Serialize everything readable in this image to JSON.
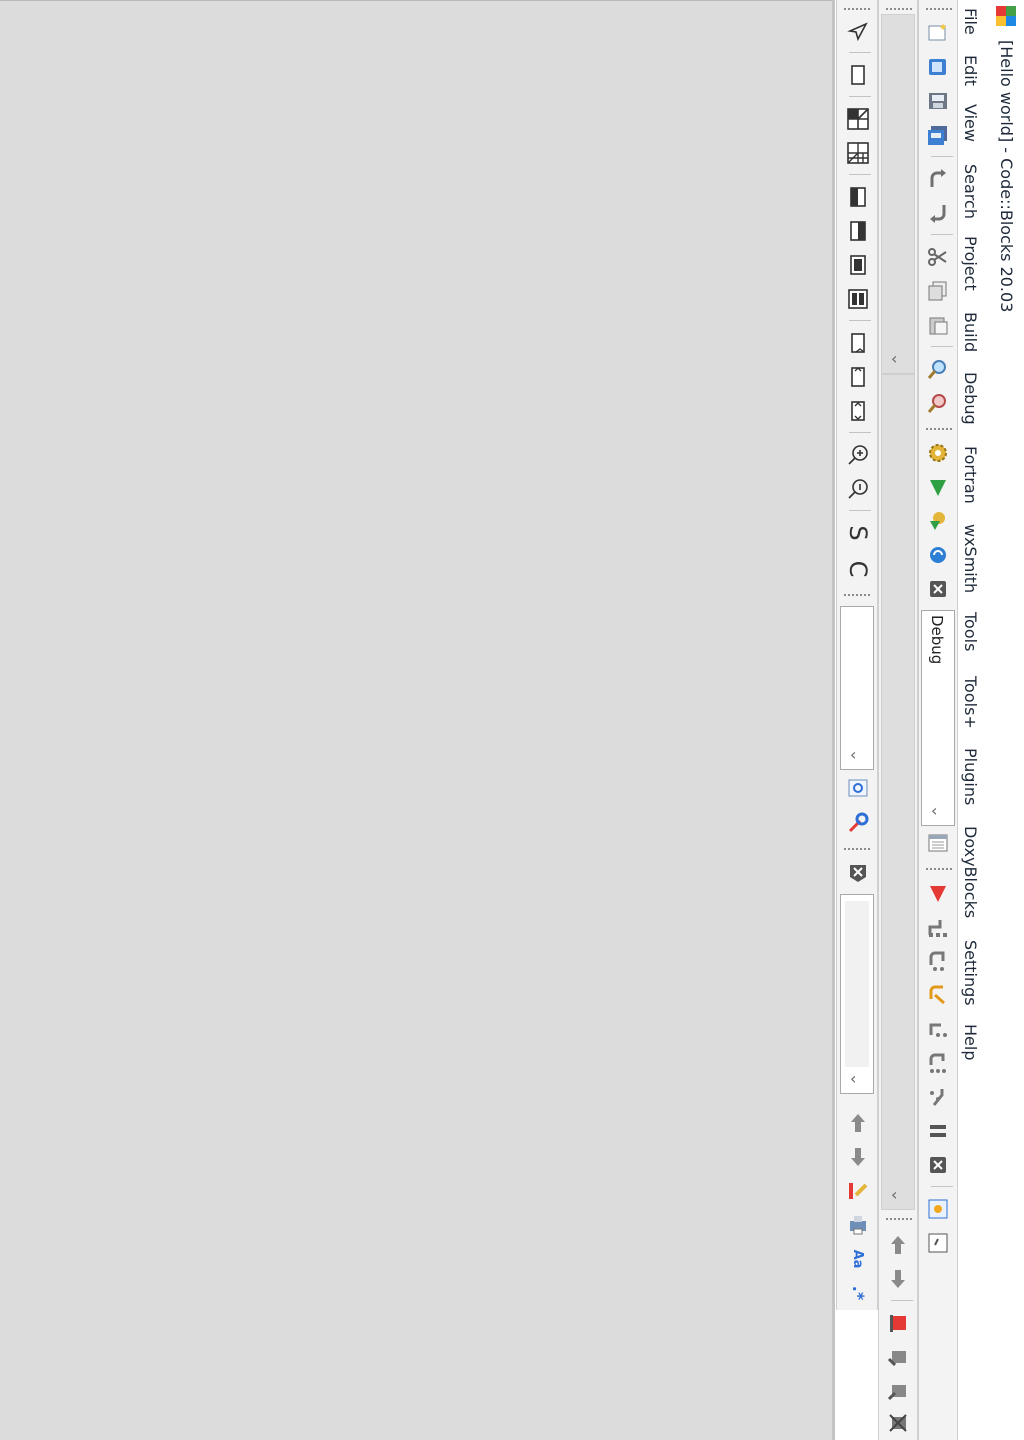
{
  "window": {
    "title": "[Hello world] - Code::Blocks 20.03"
  },
  "menu": {
    "items": [
      "File",
      "Edit",
      "View",
      "Search",
      "Project",
      "Build",
      "Debug",
      "Fortran",
      "wxSmith",
      "Tools",
      "Tools+",
      "Plugins",
      "DoxyBlocks",
      "Settings",
      "Help"
    ]
  },
  "debug_toolbar": {
    "target_label": "Debug"
  },
  "icons": {
    "app": "codeblocks-logo-icon",
    "left_toolbar": [
      "pointer-icon",
      "rectangle-icon",
      "split-view-icon",
      "grid-icon",
      "layout-left-icon",
      "layout-right-icon",
      "layout-top-icon",
      "layout-both-icon",
      "page-icon",
      "fit-icon",
      "fit-all-icon",
      "zoom-in-icon",
      "zoom-out-icon",
      "s-icon",
      "c-icon"
    ],
    "search_tools": [
      "find-icon",
      "settings-wrench-icon"
    ],
    "codecompletion": [
      "close-icon"
    ],
    "nav_tools": [
      "arrow-up-icon",
      "arrow-down-icon",
      "highlight-icon",
      "print-icon",
      "match-case-icon",
      "regex-icon"
    ],
    "main_tools": [
      "new-file-icon",
      "open-icon",
      "save-icon",
      "save-all-icon",
      "redo-icon",
      "undo-icon",
      "cut-icon",
      "copy-icon",
      "paste-icon",
      "find-icon",
      "replace-icon"
    ],
    "build_tools": [
      "build-gear-icon",
      "run-icon",
      "build-run-icon",
      "rebuild-icon",
      "abort-icon"
    ],
    "debugger_tools": [
      "debug-window-icon",
      "debug-start-icon",
      "step-into-icon",
      "step-over-icon",
      "step-out-icon",
      "next-line-icon",
      "next-instruction-icon",
      "step-instruction-icon",
      "pause-icon",
      "stop-icon",
      "info-icon",
      "windows-icon"
    ],
    "bookmark_tools": [
      "arrow-up-icon",
      "arrow-down-icon",
      "bookmark-toggle-icon",
      "bookmark-prev-icon",
      "bookmark-next-icon",
      "bookmark-clear-icon"
    ]
  },
  "colors": {
    "workspace": "#dcdcdc",
    "toolbar": "#f3f3f3",
    "run_green": "#2ea043",
    "debug_red": "#e53935"
  }
}
